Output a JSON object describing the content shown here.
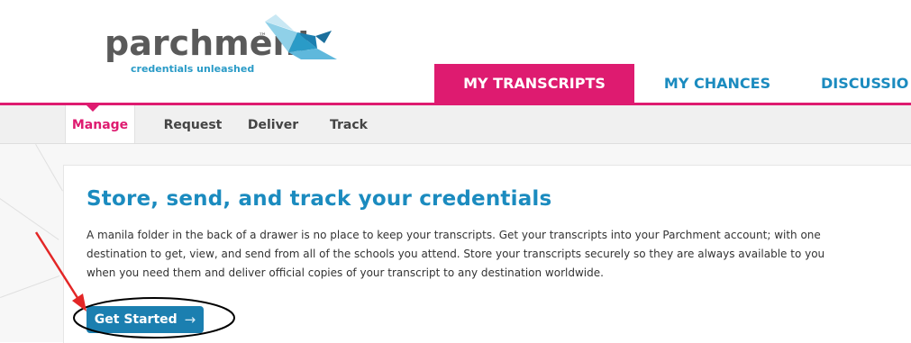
{
  "brand": {
    "name": "parchment",
    "tm": "™",
    "tagline": "credentials unleashed",
    "colors": {
      "pink": "#de1b70",
      "blue": "#1b8bbf",
      "button": "#1b7fb0"
    }
  },
  "main_nav": {
    "home_icon": "home-icon",
    "tabs": [
      {
        "label": "MY TRANSCRIPTS",
        "active": true
      },
      {
        "label": "MY CHANCES",
        "active": false
      },
      {
        "label": "DISCUSSIO",
        "active": false
      }
    ]
  },
  "sub_nav": {
    "tabs": [
      {
        "label": "Manage",
        "active": true
      },
      {
        "label": "Request",
        "active": false
      },
      {
        "label": "Deliver",
        "active": false
      },
      {
        "label": "Track",
        "active": false
      }
    ]
  },
  "content": {
    "headline": "Store, send, and track your credentials",
    "description_lines": [
      "A manila folder in the back of a drawer is no place to keep your transcripts. Get your transcripts into your Parchment account; with one",
      "destination to get, view, and send from all of the schools you attend. Store your transcripts securely so they are always available to you",
      "when you need them and deliver official copies of your transcript to any destination worldwide."
    ],
    "cta": {
      "label": "Get Started",
      "arrow": "→"
    }
  }
}
